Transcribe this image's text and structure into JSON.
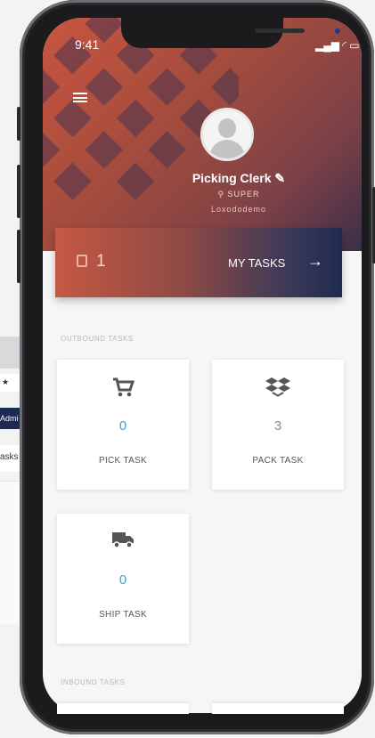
{
  "status_bar": {
    "time": "9:41",
    "icons": "▂▄▆ ◜ ▭"
  },
  "profile": {
    "name": "Picking Clerk ✎",
    "role": "⚲ SUPER",
    "company": "Loxododemo"
  },
  "my_tasks": {
    "count": "1",
    "label": "MY TASKS",
    "arrow": "→"
  },
  "outbound": {
    "title": "OUTBOUND TASKS",
    "cards": [
      {
        "icon": "cart-icon",
        "count": "0",
        "label": "PICK TASK"
      },
      {
        "icon": "dropbox-icon",
        "count": "3",
        "label": "PACK TASK"
      },
      {
        "icon": "truck-icon",
        "count": "0",
        "label": "SHIP TASK"
      }
    ]
  },
  "inbound": {
    "title": "INBOUND TASKS"
  },
  "background_page": {
    "tab_label": "★",
    "nav_label": "Admi",
    "text": "asks"
  },
  "colors": {
    "accent_blue": "#3e9fd6",
    "header_red": "#c9553e",
    "navy": "#1f2a50"
  }
}
